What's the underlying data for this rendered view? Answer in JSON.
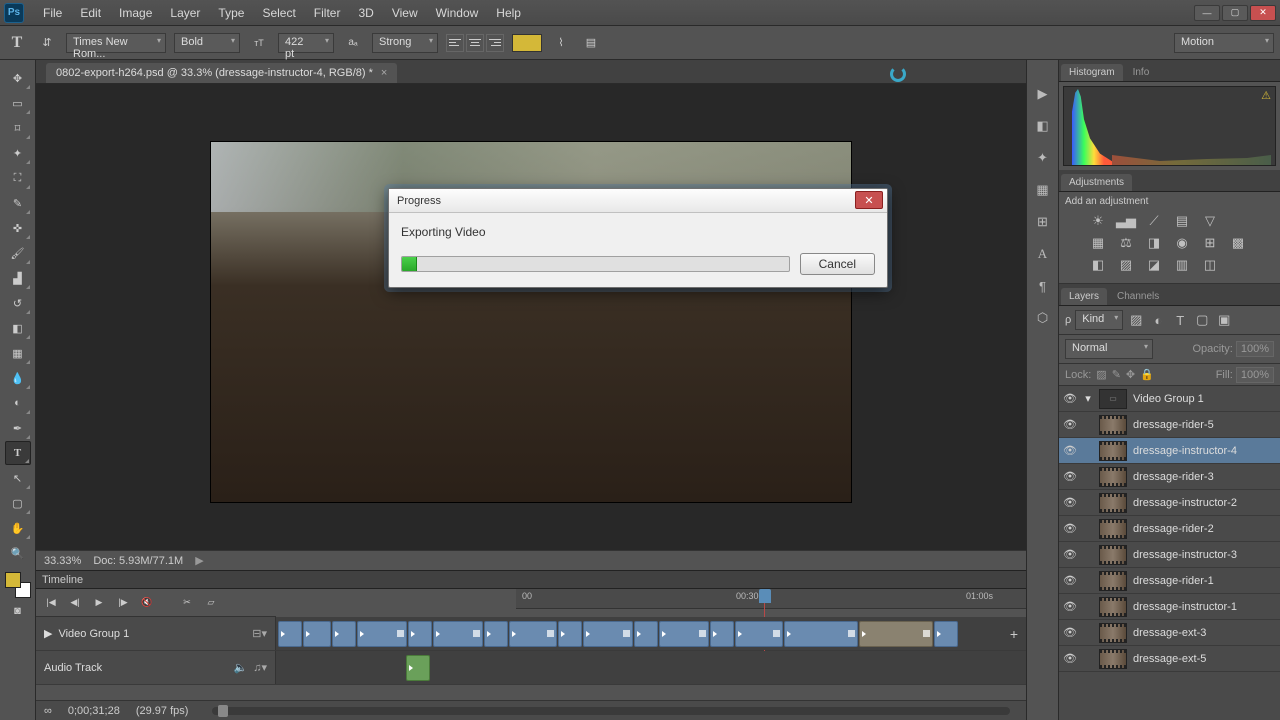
{
  "app": {
    "logo_text": "Ps"
  },
  "menu": [
    "File",
    "Edit",
    "Image",
    "Layer",
    "Type",
    "Select",
    "Filter",
    "3D",
    "View",
    "Window",
    "Help"
  ],
  "options": {
    "font_family": "Times New Rom...",
    "font_weight": "Bold",
    "font_size": "422 pt",
    "aa": "Strong",
    "motion": "Motion"
  },
  "doc_tab": "0802-export-h264.psd @ 33.3% (dressage-instructor-4, RGB/8) *",
  "status": {
    "zoom": "33.33%",
    "doc": "Doc: 5.93M/77.1M"
  },
  "timeline": {
    "title": "Timeline",
    "group": "Video Group 1",
    "audio": "Audio Track",
    "ticks": {
      "t0": "00",
      "t1": "00:30",
      "t2": "01:00s"
    },
    "timecode": "0;00;31;28",
    "fps": "(29.97 fps)"
  },
  "panels": {
    "histogram": "Histogram",
    "info": "Info",
    "adjustments": "Adjustments",
    "add_adj": "Add an adjustment",
    "layers": "Layers",
    "channels": "Channels",
    "kind": "Kind",
    "blend": "Normal",
    "opacity_label": "Opacity:",
    "opacity_val": "100%",
    "lock_label": "Lock:",
    "fill_label": "Fill:",
    "fill_val": "100%"
  },
  "layers": [
    {
      "name": "Video Group 1",
      "group": true
    },
    {
      "name": "dressage-rider-5"
    },
    {
      "name": "dressage-instructor-4",
      "selected": true
    },
    {
      "name": "dressage-rider-3"
    },
    {
      "name": "dressage-instructor-2"
    },
    {
      "name": "dressage-rider-2"
    },
    {
      "name": "dressage-instructor-3"
    },
    {
      "name": "dressage-rider-1"
    },
    {
      "name": "dressage-instructor-1"
    },
    {
      "name": "dressage-ext-3"
    },
    {
      "name": "dressage-ext-5"
    }
  ],
  "dialog": {
    "title": "Progress",
    "message": "Exporting Video",
    "cancel": "Cancel",
    "percent": 4
  }
}
